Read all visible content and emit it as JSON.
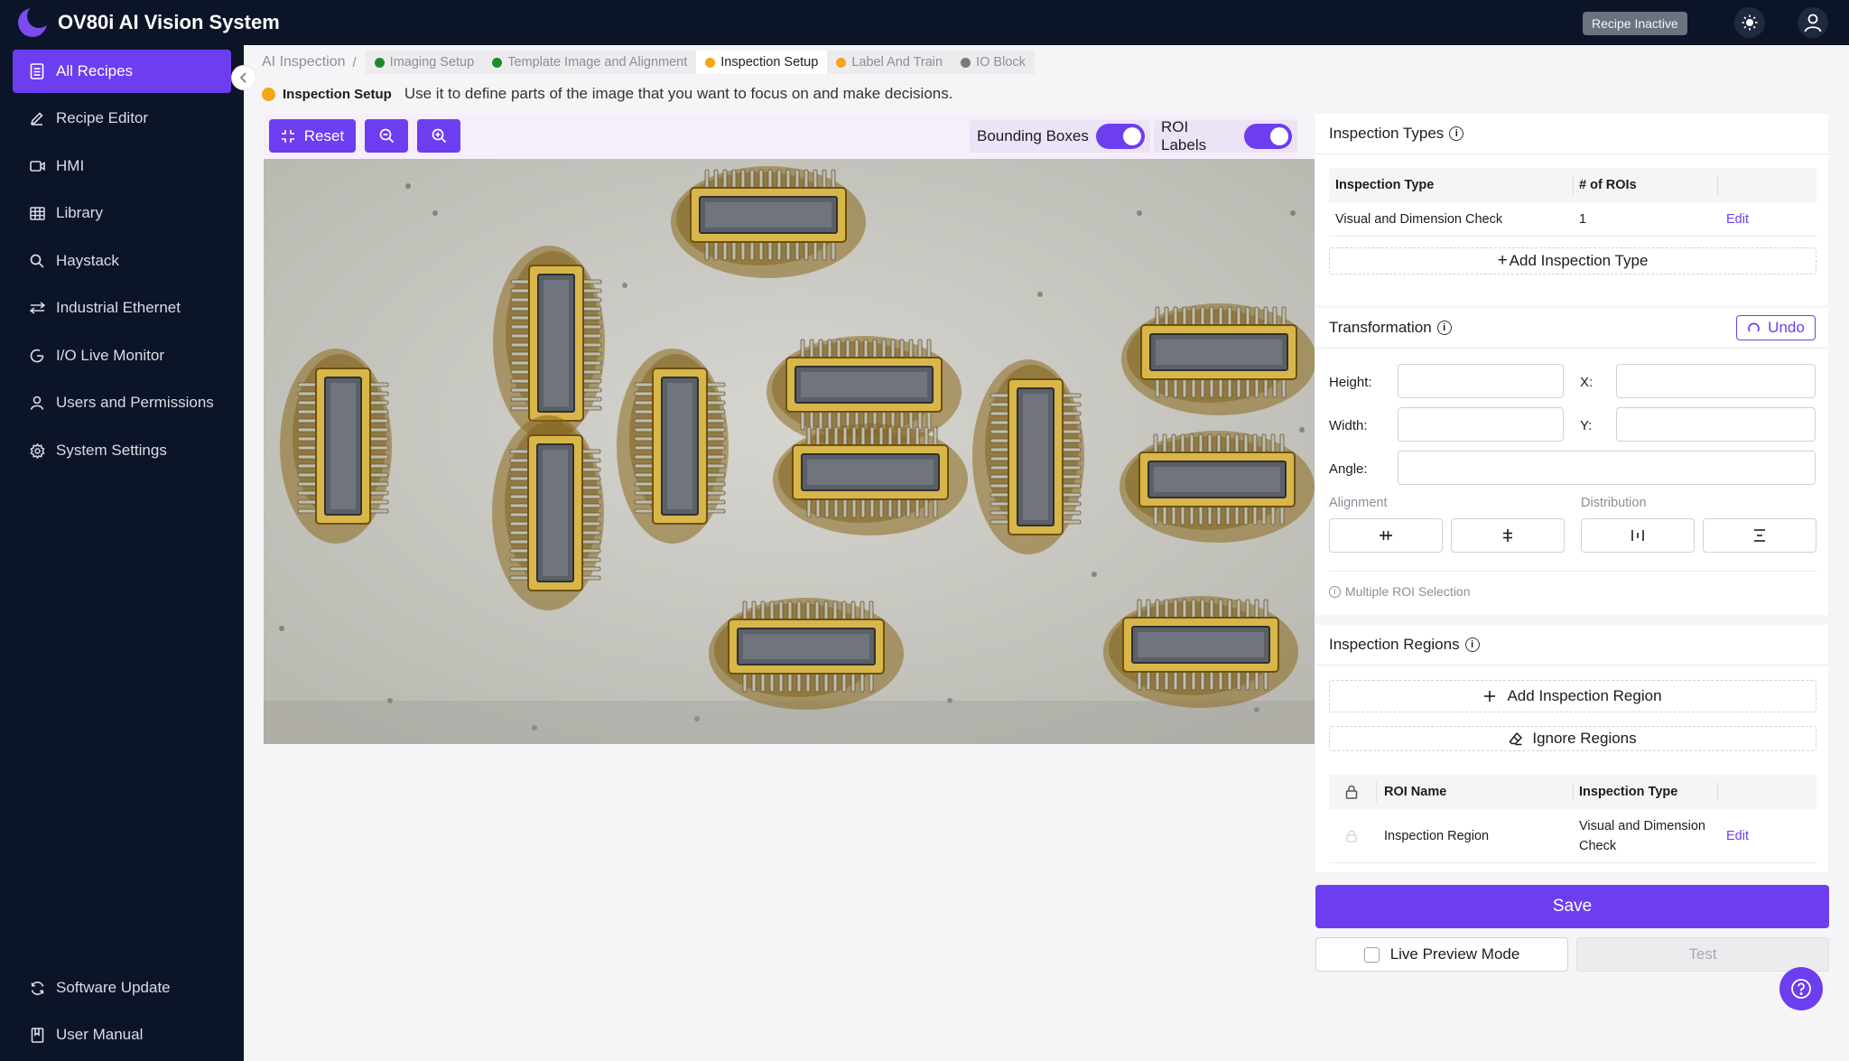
{
  "header": {
    "app_title": "OV80i AI Vision System",
    "status_badge": "Recipe Inactive",
    "theme_icon": "sun-icon",
    "user_icon": "user-icon"
  },
  "sidebar": {
    "items": [
      {
        "label": "All Recipes",
        "icon": "document-icon",
        "active": true
      },
      {
        "label": "Recipe Editor",
        "icon": "pencil-icon"
      },
      {
        "label": "HMI",
        "icon": "video-icon"
      },
      {
        "label": "Library",
        "icon": "grid-icon"
      },
      {
        "label": "Haystack",
        "icon": "search-icon"
      },
      {
        "label": "Industrial Ethernet",
        "icon": "network-icon"
      },
      {
        "label": "I/O Live Monitor",
        "icon": "monitor-icon"
      },
      {
        "label": "Users and Permissions",
        "icon": "user-icon"
      },
      {
        "label": "System Settings",
        "icon": "gear-icon"
      }
    ],
    "footer": [
      {
        "label": "Software Update",
        "icon": "refresh-icon"
      },
      {
        "label": "User Manual",
        "icon": "book-icon"
      }
    ]
  },
  "breadcrumb": {
    "root": "AI Inspection",
    "separator": "/",
    "steps": [
      {
        "label": "Imaging Setup",
        "color": "#1e8a2e"
      },
      {
        "label": "Template Image and Alignment",
        "color": "#1e8a2e"
      },
      {
        "label": "Inspection Setup",
        "color": "#f5a516",
        "current": true
      },
      {
        "label": "Label And Train",
        "color": "#f5a516"
      },
      {
        "label": "IO Block",
        "color": "#7a7a7a"
      }
    ]
  },
  "step_description": {
    "name": "Inspection Setup",
    "text": "Use it to define parts of the image that you want to focus on and make decisions."
  },
  "toolbar": {
    "reset_label": "Reset",
    "zoom_out_icon": "zoom-out-icon",
    "zoom_in_icon": "zoom-in-icon",
    "bounding_boxes_label": "Bounding Boxes",
    "bounding_boxes_on": true,
    "roi_labels_label": "ROI Labels",
    "roi_labels_on": true
  },
  "inspection_types": {
    "title": "Inspection Types",
    "columns": [
      "Inspection Type",
      "# of ROIs"
    ],
    "rows": [
      {
        "type": "Visual and Dimension Check",
        "rois": "1",
        "action": "Edit"
      }
    ],
    "add_label": "Add Inspection Type"
  },
  "transformation": {
    "title": "Transformation",
    "undo_label": "Undo",
    "height_label": "Height:",
    "x_label": "X:",
    "width_label": "Width:",
    "y_label": "Y:",
    "angle_label": "Angle:",
    "height_value": "",
    "x_value": "",
    "width_value": "",
    "y_value": "",
    "angle_value": "",
    "alignment_label": "Alignment",
    "distribution_label": "Distribution",
    "multi_roi_note": "Multiple ROI Selection"
  },
  "inspection_regions": {
    "title": "Inspection Regions",
    "add_label": "Add Inspection Region",
    "ignore_label": "Ignore Regions",
    "columns": [
      "ROI Name",
      "Inspection Type"
    ],
    "rows": [
      {
        "name": "Inspection Region",
        "type_line1": "Visual and Dimension",
        "type_line2": "Check",
        "action": "Edit"
      }
    ]
  },
  "actions": {
    "save_label": "Save",
    "live_preview_label": "Live Preview Mode",
    "live_preview_checked": false,
    "test_label": "Test"
  },
  "colors": {
    "accent": "#6d3df0",
    "sidebar_bg": "#0c1427",
    "status_green": "#1e8a2e",
    "status_orange": "#f5a516",
    "status_gray": "#7a7a7a"
  }
}
